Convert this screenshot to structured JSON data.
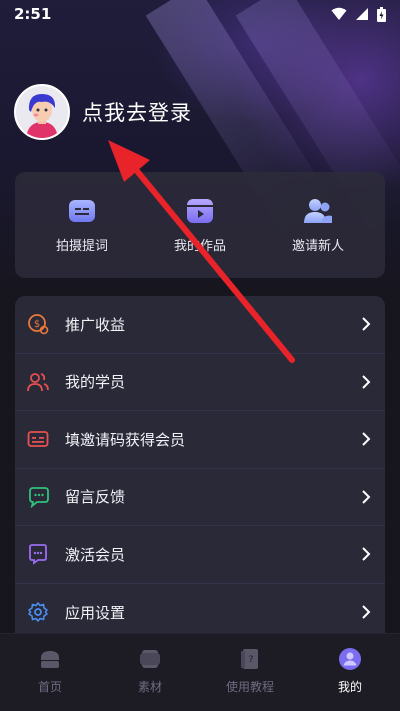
{
  "status_bar": {
    "time": "2:51"
  },
  "profile": {
    "login_prompt": "点我去登录"
  },
  "quick_actions": [
    {
      "label": "拍摄提词",
      "icon": "teleprompter-icon"
    },
    {
      "label": "我的作品",
      "icon": "video-works-icon"
    },
    {
      "label": "邀请新人",
      "icon": "invite-users-icon"
    }
  ],
  "menu": [
    {
      "label": "推广收益",
      "icon": "earnings-coin-icon",
      "color": "#e8793a"
    },
    {
      "label": "我的学员",
      "icon": "students-icon",
      "color": "#e8504f"
    },
    {
      "label": "填邀请码获得会员",
      "icon": "invite-code-icon",
      "color": "#e8504f"
    },
    {
      "label": "留言反馈",
      "icon": "feedback-chat-icon",
      "color": "#2fc27a"
    },
    {
      "label": "激活会员",
      "icon": "activate-member-icon",
      "color": "#9b6cf0"
    },
    {
      "label": "应用设置",
      "icon": "settings-gear-icon",
      "color": "#4a8ef0"
    }
  ],
  "bottom_nav": [
    {
      "label": "首页",
      "icon": "home-icon",
      "active": false
    },
    {
      "label": "素材",
      "icon": "materials-icon",
      "active": false
    },
    {
      "label": "使用教程",
      "icon": "tutorial-icon",
      "active": false
    },
    {
      "label": "我的",
      "icon": "profile-icon",
      "active": true
    }
  ],
  "colors": {
    "accent": "#7b6df0",
    "annotation_arrow": "#e8232a"
  }
}
